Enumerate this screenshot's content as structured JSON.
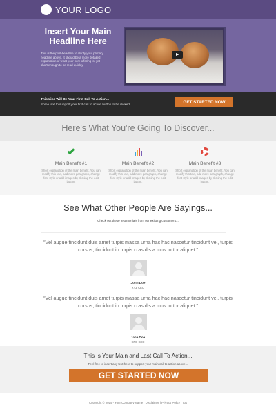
{
  "header": {
    "logo_text": "YOUR LOGO"
  },
  "hero": {
    "headline": "Insert Your Main Headline Here",
    "subtext": "This is the post-headline to clarify your primary headline above. It should be a more detailed explanation of what your core offering is, yet short enough to be read quickly.",
    "video_icon": "play-icon"
  },
  "cta_bar": {
    "title": "This Line Will Be Your First Call To Action...",
    "subtitle": "Some text to support your first call to action button to be clicked...",
    "button": "GET STARTED NOW",
    "button_color": "#d3742b"
  },
  "discover": {
    "heading": "Here's What You're Going To Discover..."
  },
  "benefits": [
    {
      "icon": "check-icon",
      "title": "Main Benefit #1",
      "text": "Short explanation of the main benefit. You can modify this text, add more paragraph, change font style or add images by clicking the edit button."
    },
    {
      "icon": "bar-chart-icon",
      "title": "Main Benefit #2",
      "text": "Short explanation of the main benefit. You can modify this text, add more paragraph, change font style or add images by clicking the edit button."
    },
    {
      "icon": "life-ring-icon",
      "title": "Main Benefit #3",
      "text": "Short explanation of the main benefit. You can modify this text, add more paragraph, change font style or add images by clicking the edit button."
    }
  ],
  "testimonials": {
    "heading": "See What Other People Are Sayings...",
    "subheading": "Check out these testimonials from our existing customers...",
    "items": [
      {
        "quote": "“Vel augue tincidunt duis amet turpis massa urna hac hac nascetur tincidunt vel, turpis cursus, tincidunt in turpis cras dis a mus tortor aliquet.”",
        "name": "John Doe",
        "role": "XYZ CEO"
      },
      {
        "quote": "“Vel augue tincidunt duis amet turpis massa urna hac hac nascetur tincidunt vel, turpis cursus, tincidunt in turpis cras dis a mus tortor aliquet.”",
        "name": "Jane Doe",
        "role": "CFG CEO"
      }
    ]
  },
  "final_cta": {
    "heading": "This Is Your Main and Last Call To Action...",
    "subtext": "Feel free to insert any text here to support your main call to action above...",
    "button": "GET STARTED NOW"
  },
  "footer": {
    "text": "Copyright © 2015 - Your Company Name  |  Disclaimer  |  Privacy Policy  |  Tos"
  },
  "colors": {
    "header": "#5b4b82",
    "hero": "#7566a0",
    "cta_bar": "#2a2a2a",
    "accent": "#d3742b"
  }
}
